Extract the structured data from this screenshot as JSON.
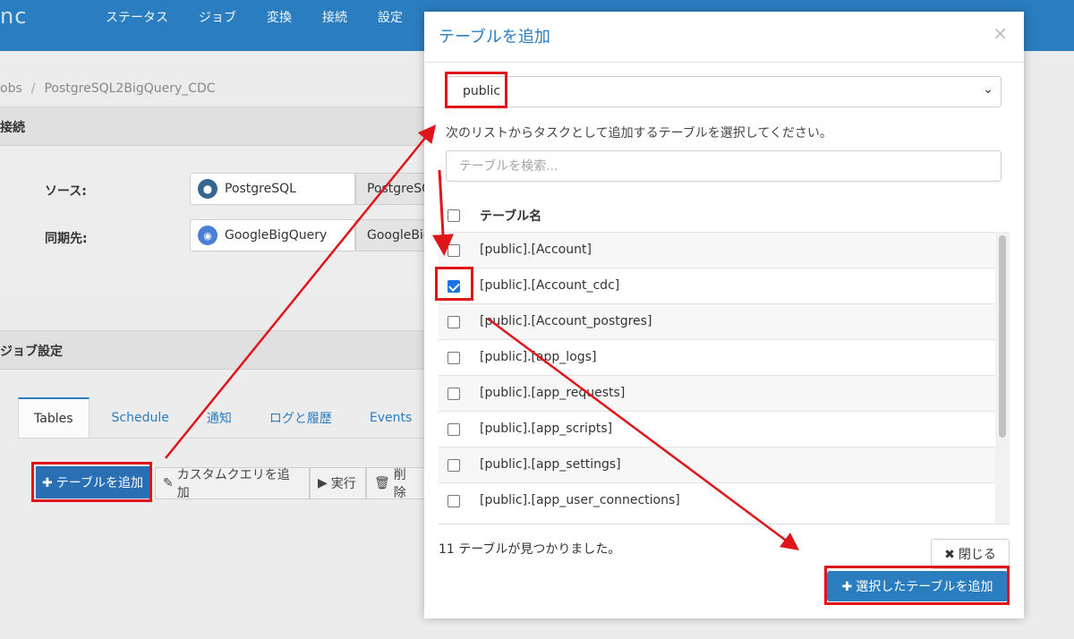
{
  "app": {
    "brand": "nc",
    "nav": [
      "ステータス",
      "ジョブ",
      "変換",
      "接続",
      "設定"
    ]
  },
  "breadcrumb": {
    "root": "obs",
    "sep": "/",
    "current": "PostgreSQL2BigQuery_CDC"
  },
  "connection_section": {
    "title": "接続",
    "source_label": "ソース:",
    "source_value": "PostgreSQL",
    "source_value2": "PostgreSQ",
    "dest_label": "同期先:",
    "dest_value": "GoogleBigQuery",
    "dest_value2": "GoogleBig"
  },
  "job_section": {
    "title": "ジョブ設定",
    "tabs": [
      "Tables",
      "Schedule",
      "通知",
      "ログと履歴",
      "Events"
    ],
    "buttons": {
      "add_table": "テーブルを追加",
      "add_custom_query": "カスタムクエリを追加",
      "run": "実行",
      "delete": "削除"
    }
  },
  "modal": {
    "title": "テーブルを追加",
    "close_symbol": "×",
    "schema_selected": "public",
    "instruction": "次のリストからタスクとして追加するテーブルを選択してください。",
    "search_placeholder": "テーブルを検索...",
    "column_header": "テーブル名",
    "rows": [
      {
        "name": "[public].[Account]",
        "checked": false
      },
      {
        "name": "[public].[Account_cdc]",
        "checked": true
      },
      {
        "name": "[public].[Account_postgres]",
        "checked": false
      },
      {
        "name": "[public].[app_logs]",
        "checked": false
      },
      {
        "name": "[public].[app_requests]",
        "checked": false
      },
      {
        "name": "[public].[app_scripts]",
        "checked": false
      },
      {
        "name": "[public].[app_settings]",
        "checked": false
      },
      {
        "name": "[public].[app_user_connections]",
        "checked": false
      }
    ],
    "count_text": "11 テーブルが見つかりました。",
    "close_button": "閉じる",
    "add_selected_button": "選択したテーブルを追加"
  },
  "colors": {
    "nav_bg": "#2a7dbf",
    "primary": "#2a7dbf",
    "highlight": "#e0151b"
  },
  "icons": {
    "plus": "plus-icon",
    "edit": "edit-icon",
    "play": "play-icon",
    "trash": "trash-icon",
    "times": "times-icon",
    "chevron": "chevron-down-icon"
  }
}
